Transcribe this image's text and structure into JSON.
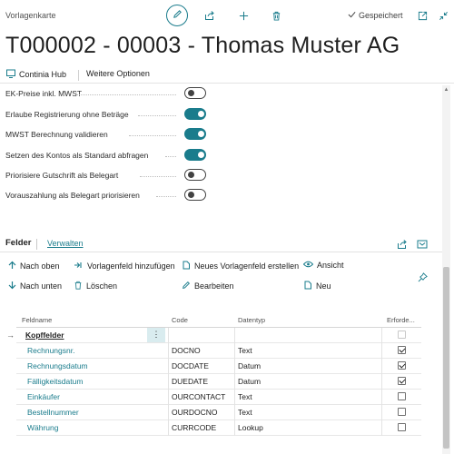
{
  "header": {
    "page_type": "Vorlagenkarte",
    "saved_label": "Gespeichert",
    "title": "T000002 - 00003 - Thomas Muster AG"
  },
  "actions": {
    "continia_hub": "Continia Hub",
    "more_options": "Weitere Optionen"
  },
  "settings": [
    {
      "label": "EK-Preise inkl. MWST",
      "on": false
    },
    {
      "label": "Erlaube Registrierung ohne Beträge",
      "on": true
    },
    {
      "label": "MWST Berechnung validieren",
      "on": true
    },
    {
      "label": "Setzen des Kontos als Standard abfragen",
      "on": true
    },
    {
      "label": "Priorisiere Gutschrift als Belegart",
      "on": false
    },
    {
      "label": "Vorauszahlung als Belegart priorisieren",
      "on": false
    }
  ],
  "fields_section": {
    "title": "Felder",
    "manage_link": "Verwalten",
    "buttons": {
      "up": "Nach oben",
      "add_field": "Vorlagenfeld hinzufügen",
      "new_field": "Neues Vorlagenfeld erstellen",
      "view": "Ansicht",
      "down": "Nach unten",
      "delete": "Löschen",
      "edit": "Bearbeiten",
      "new": "Neu"
    },
    "columns": {
      "name": "Feldname",
      "code": "Code",
      "data_type": "Datentyp",
      "required": "Erforde..."
    },
    "rows": [
      {
        "name": "Kopffelder",
        "code": "",
        "data_type": "",
        "required": false,
        "header": true
      },
      {
        "name": "Rechnungsnr.",
        "code": "DOCNO",
        "data_type": "Text",
        "required": true
      },
      {
        "name": "Rechnungsdatum",
        "code": "DOCDATE",
        "data_type": "Datum",
        "required": true
      },
      {
        "name": "Fälligkeitsdatum",
        "code": "DUEDATE",
        "data_type": "Datum",
        "required": true
      },
      {
        "name": "Einkäufer",
        "code": "OURCONTACT",
        "data_type": "Text",
        "required": false
      },
      {
        "name": "Bestellnummer",
        "code": "OURDOCNO",
        "data_type": "Text",
        "required": false
      },
      {
        "name": "Währung",
        "code": "CURRCODE",
        "data_type": "Lookup",
        "required": false
      }
    ]
  },
  "colors": {
    "accent": "#1a7c8c",
    "toggle_off": "#424242"
  }
}
